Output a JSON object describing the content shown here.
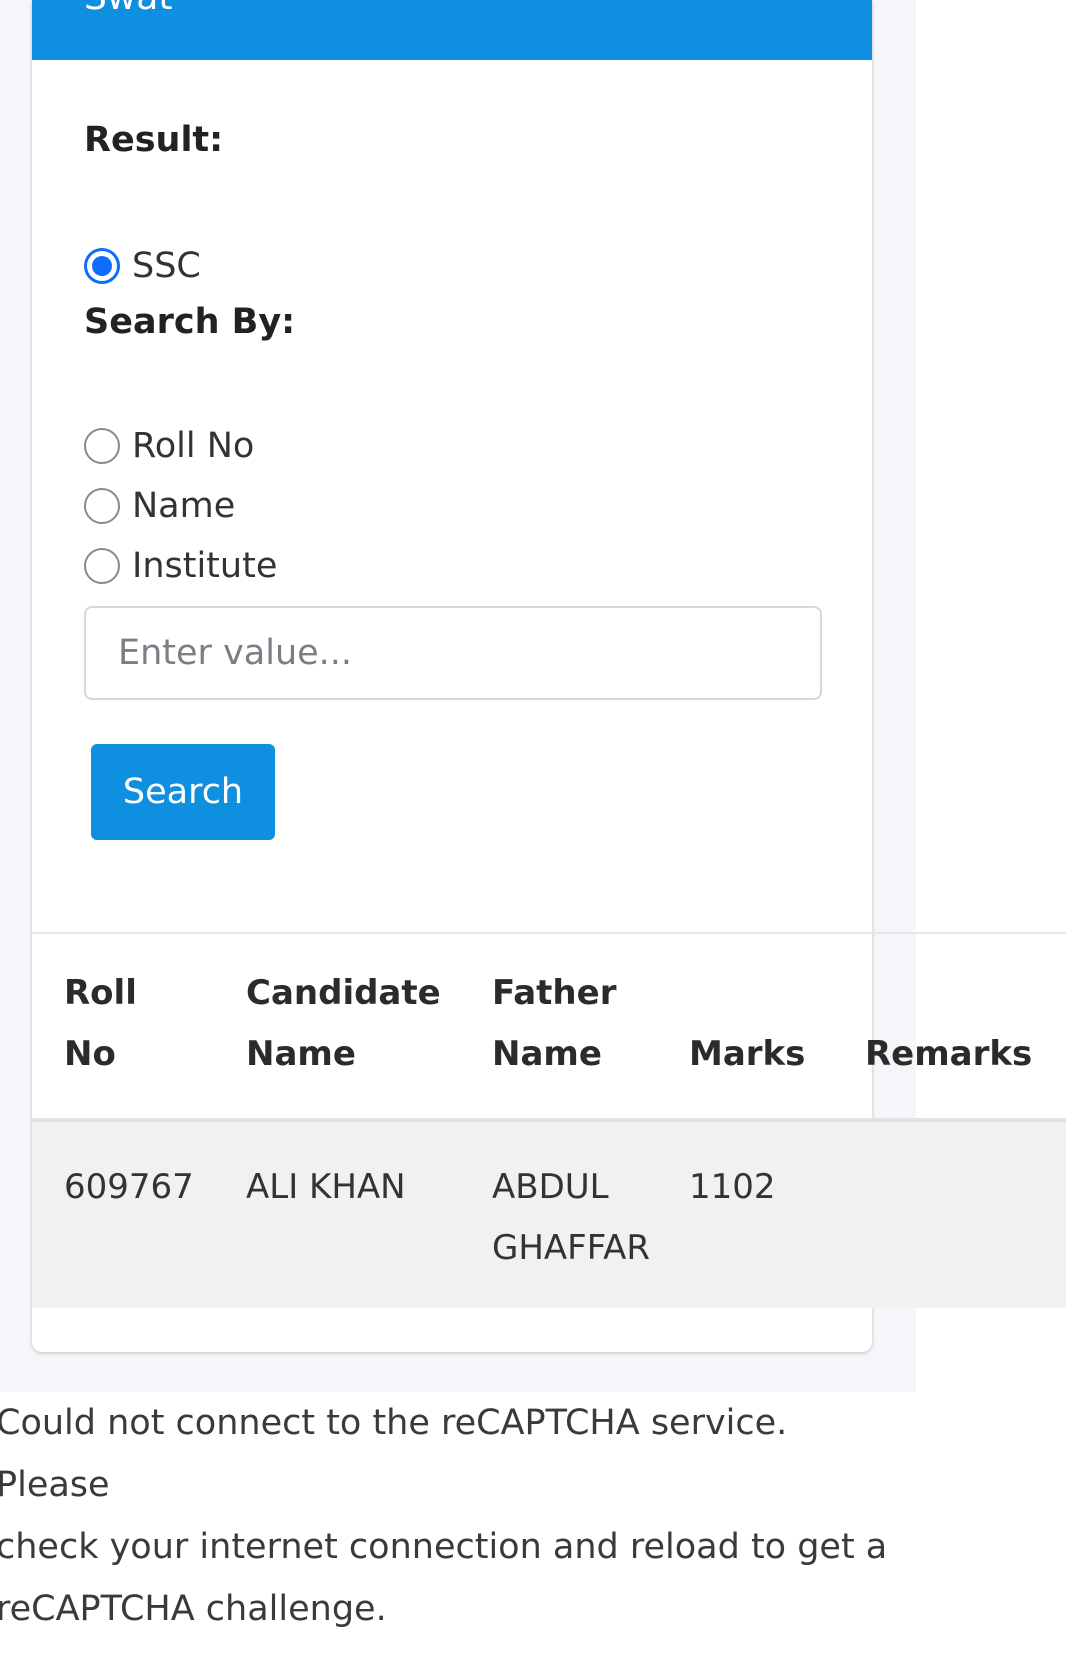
{
  "card": {
    "title": "Swat"
  },
  "form": {
    "result_label": "Result:",
    "result_options": [
      {
        "label": "SSC",
        "checked": true
      }
    ],
    "search_by_label": "Search By:",
    "search_by_options": [
      {
        "label": "Roll No",
        "checked": false
      },
      {
        "label": "Name",
        "checked": false
      },
      {
        "label": "Institute",
        "checked": false
      }
    ],
    "input_placeholder": "Enter value...",
    "input_value": "",
    "search_button": "Search"
  },
  "table": {
    "headers": {
      "roll_line1": "Roll",
      "roll_line2": "No",
      "candidate_line1": "Candidate",
      "candidate_line2": "Name",
      "father_line1": "Father",
      "father_line2": "Name",
      "marks": "Marks",
      "remarks": "Remarks"
    },
    "rows": [
      {
        "roll_no": "609767",
        "candidate_name": "ALI KHAN",
        "father_line1": "ABDUL",
        "father_line2": "GHAFFAR",
        "marks": "1102",
        "remarks": ""
      }
    ]
  },
  "recaptcha_notice": {
    "line1": "Could not connect to the reCAPTCHA service. Please",
    "line2": "check your internet connection and reload to get a",
    "line3": "reCAPTCHA challenge."
  },
  "colors": {
    "primary": "#0e8fdf",
    "radio_checked": "#0d6efd",
    "row_stripe": "#f1f1f1"
  }
}
